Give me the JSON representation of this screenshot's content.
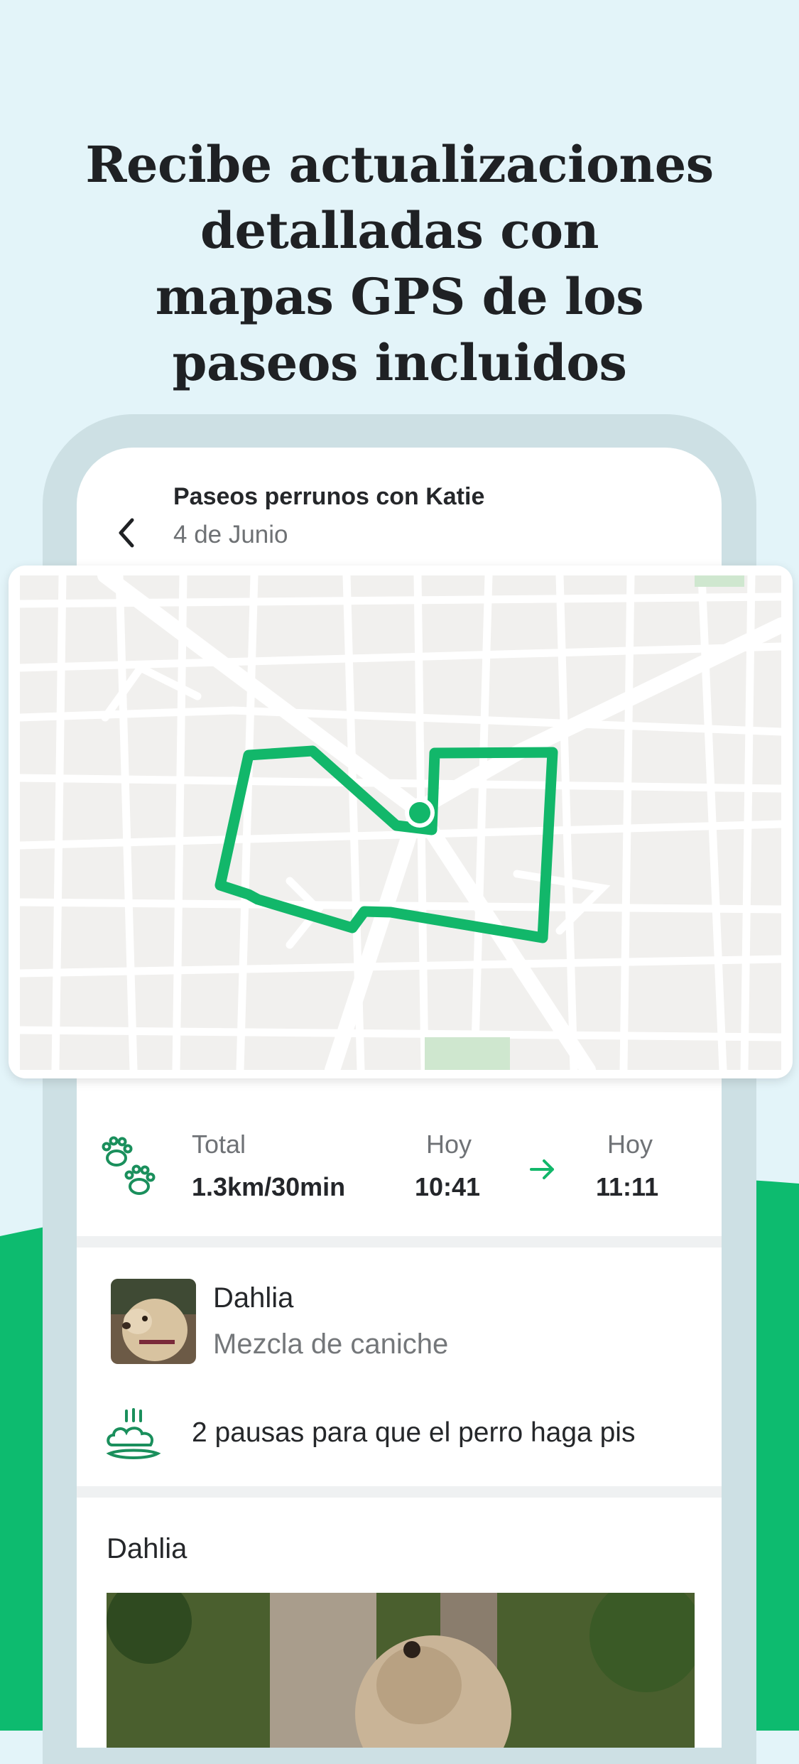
{
  "headline": {
    "lines": [
      "Recibe actualizaciones",
      "detalladas con",
      "mapas GPS de los",
      "paseos incluidos"
    ]
  },
  "header": {
    "title": "Paseos perrunos con Katie",
    "date": "4 de Junio",
    "back_icon": "chevron-left-icon"
  },
  "map": {
    "route_color": "#12b76a"
  },
  "walk_stats": {
    "icon": "paw-prints-icon",
    "total_label": "Total",
    "total_value": "1.3km/30min",
    "start_label": "Hoy",
    "start_time": "10:41",
    "arrow_icon": "arrow-right-icon",
    "end_label": "Hoy",
    "end_time": "11:11"
  },
  "dog": {
    "name": "Dahlia",
    "breed": "Mezcla de caniche"
  },
  "pee_breaks": {
    "icon": "pee-break-icon",
    "text": "2 pausas para que el perro haga pis"
  },
  "photo_section": {
    "title": "Dahlia"
  },
  "colors": {
    "background": "#e3f4f9",
    "accent_green": "#0dbb6f",
    "frame": "#cde0e4"
  }
}
